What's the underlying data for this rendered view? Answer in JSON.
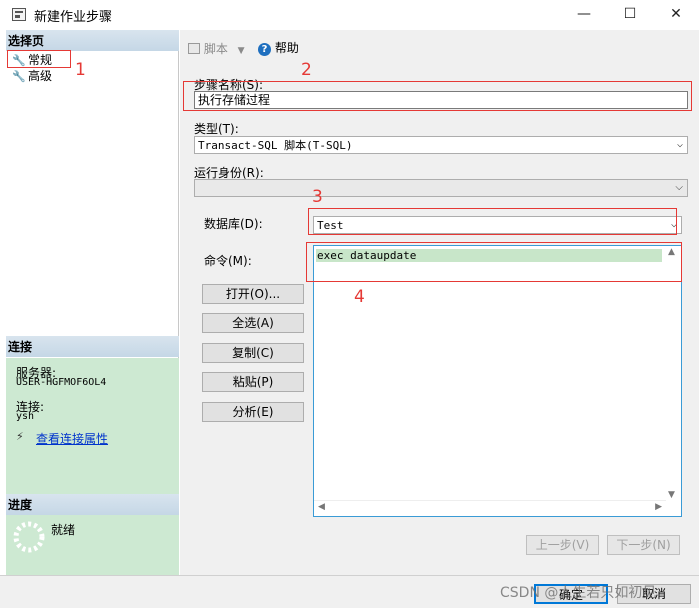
{
  "window": {
    "title": "新建作业步骤",
    "controls": [
      "minimize",
      "maximize",
      "close"
    ]
  },
  "left": {
    "select_page_header": "选择页",
    "pages": [
      {
        "label": "常规",
        "icon": "wrench-icon"
      },
      {
        "label": "高级",
        "icon": "wrench-icon"
      }
    ],
    "connection_header": "连接",
    "server_label": "服务器:",
    "server_value": "USER-HGFMOF6OL4",
    "connection_label": "连接:",
    "connection_value": "ysh",
    "view_conn_link": "查看连接属性",
    "progress_header": "进度",
    "progress_status": "就绪"
  },
  "toolbar": {
    "script_label": "脚本",
    "help_label": "帮助"
  },
  "form": {
    "step_name_label": "步骤名称(S):",
    "step_name_value": "执行存储过程",
    "type_label": "类型(T):",
    "type_value": "Transact-SQL 脚本(T-SQL)",
    "run_as_label": "运行身份(R):",
    "run_as_value": "",
    "database_label": "数据库(D):",
    "database_value": "Test",
    "command_label": "命令(M):",
    "command_value": "exec dataupdate",
    "buttons": {
      "open": "打开(O)...",
      "select_all": "全选(A)",
      "copy": "复制(C)",
      "paste": "粘贴(P)",
      "parse": "分析(E)"
    },
    "prev_step": "上一步(V)",
    "next_step": "下一步(N)"
  },
  "footer": {
    "ok": "确定",
    "cancel": "取消"
  },
  "annotations": [
    "1",
    "2",
    "3",
    "4"
  ],
  "watermark": "CSDN @人生若只如初见",
  "colors": {
    "annotation_red": "#e53935",
    "section_green": "#cde9d2",
    "highlight_green": "#c8e6c9",
    "link_blue": "#0033cc"
  }
}
